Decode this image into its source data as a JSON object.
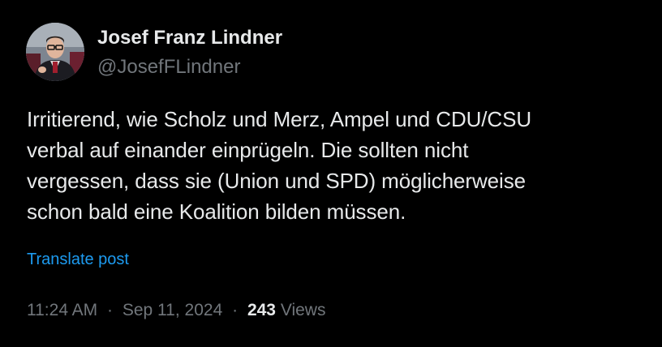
{
  "author": {
    "display_name": "Josef Franz Lindner",
    "handle": "@JosefFLindner"
  },
  "tweet": {
    "lines": [
      "Irritierend, wie Scholz und Merz, Ampel und CDU/CSU",
      "verbal auf einander einprügeln. Die sollten nicht",
      "vergessen, dass sie (Union und SPD) möglicherweise",
      "schon bald eine Koalition bilden müssen."
    ],
    "translate_label": "Translate post"
  },
  "meta": {
    "time": "11:24 AM",
    "separator": "·",
    "date": "Sep 11, 2024",
    "views_count": "243",
    "views_label": "Views"
  },
  "colors": {
    "background": "#000000",
    "primary_text": "#e7e9ea",
    "secondary_text": "#71767b",
    "link": "#1d9bf0"
  }
}
